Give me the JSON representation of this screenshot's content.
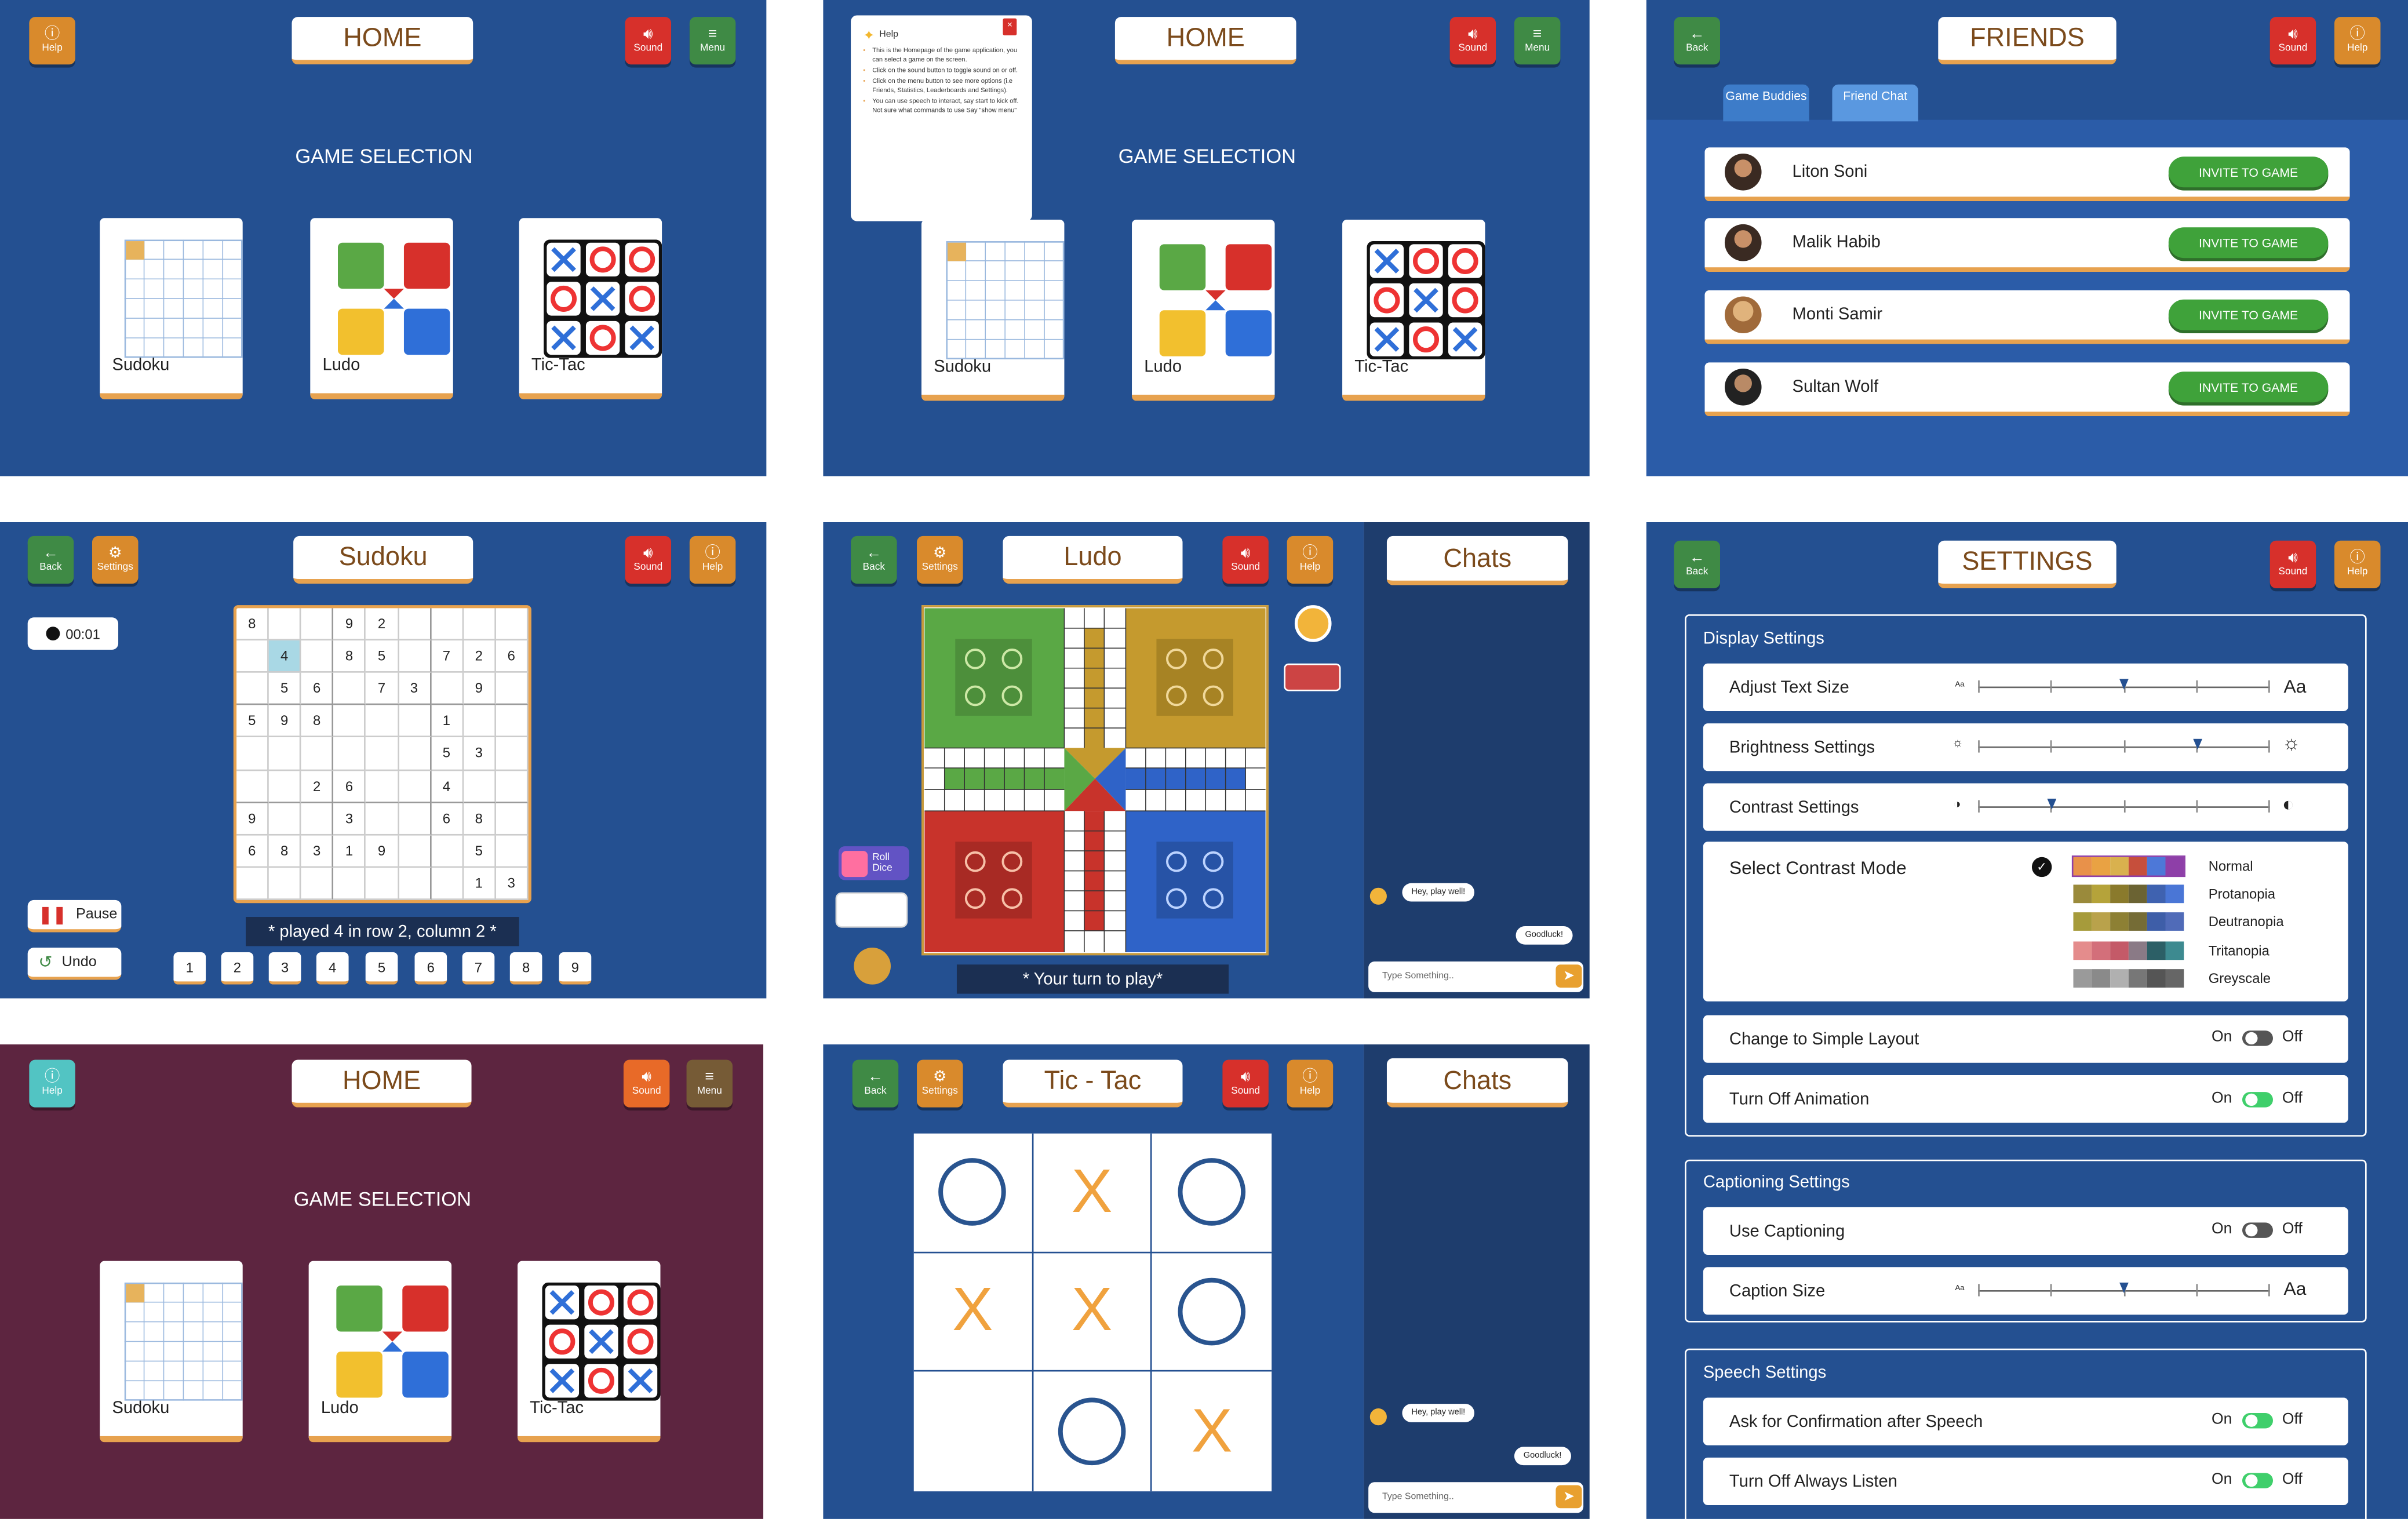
{
  "common": {
    "help": "Help",
    "sound": "Sound",
    "menu": "Menu",
    "back": "Back",
    "settings": "Settings",
    "game_selection": "GAME SELECTION",
    "home": "HOME",
    "chats": "Chats",
    "type_placeholder": "Type Something..",
    "msg_in": "Hey, play well!",
    "msg_out": "Goodluck!"
  },
  "games": [
    {
      "name": "Sudoku",
      "icon": "sudoku-icon"
    },
    {
      "name": "Ludo",
      "icon": "ludo-icon"
    },
    {
      "name": "Tic-Tac",
      "icon": "tictac-icon"
    }
  ],
  "help_popup": {
    "title": "Help",
    "items": [
      "This is the Homepage of the game application, you can select a game on the screen.",
      "Click on the sound button to toggle sound on or off.",
      "Click on the menu button to see more options (i.e Friends, Statistics, Leaderboards and Settings).",
      "You can use speech to interact, say start to kick off. Not sure what commands to use Say \"show menu\""
    ]
  },
  "friends": {
    "title": "FRIENDS",
    "tabs": [
      "Game Buddies",
      "Friend Chat"
    ],
    "invite_label": "INVITE TO GAME",
    "list": [
      "Liton Soni",
      "Malik Habib",
      "Monti Samir",
      "Sultan Wolf"
    ]
  },
  "sudoku": {
    "title": "Sudoku",
    "timer": "00:01",
    "pause": "Pause",
    "undo": "Undo",
    "status": "* played 4 in row 2, column 2 *",
    "keypad": [
      "1",
      "2",
      "3",
      "4",
      "5",
      "6",
      "7",
      "8",
      "9"
    ],
    "grid": [
      [
        "8",
        "",
        "",
        "9",
        "2",
        "",
        "",
        "",
        ""
      ],
      [
        "",
        "4",
        "",
        "8",
        "5",
        "",
        "7",
        "2",
        "6"
      ],
      [
        "",
        "5",
        "6",
        "",
        "7",
        "3",
        "",
        "9",
        ""
      ],
      [
        "5",
        "9",
        "8",
        "",
        "",
        "",
        "1",
        "",
        ""
      ],
      [
        "",
        "",
        "",
        "",
        "",
        "",
        "5",
        "3",
        ""
      ],
      [
        "",
        "",
        "2",
        "6",
        "",
        "",
        "4",
        "",
        ""
      ],
      [
        "9",
        "",
        "",
        "3",
        "",
        "",
        "6",
        "8",
        ""
      ],
      [
        "6",
        "8",
        "3",
        "1",
        "9",
        "",
        "",
        "5",
        ""
      ],
      [
        "",
        "",
        "",
        "",
        "",
        "",
        "",
        "1",
        "3"
      ]
    ]
  },
  "ludo": {
    "title": "Ludo",
    "roll": "Roll Dice",
    "status": "* Your turn to play*"
  },
  "tictac": {
    "title": "Tic - Tac",
    "board": [
      "O",
      "X",
      "O",
      "X",
      "X",
      "O",
      "",
      "O",
      "X"
    ]
  },
  "settings_page": {
    "title": "SETTINGS",
    "display": {
      "heading": "Display Settings",
      "text_size": "Adjust Text Size",
      "brightness": "Brightness Settings",
      "contrast": "Contrast Settings",
      "contrast_mode": "Select Contrast Mode",
      "modes": [
        "Normal",
        "Protanopia",
        "Deutranopia",
        "Tritanopia",
        "Greyscale"
      ],
      "simple_layout": "Change to Simple Layout",
      "animation": "Turn Off Animation"
    },
    "captioning": {
      "heading": "Captioning Settings",
      "use": "Use Captioning",
      "size": "Caption Size"
    },
    "speech": {
      "heading": "Speech Settings",
      "confirm": "Ask for Confirmation after Speech",
      "listen": "Turn Off Always Listen"
    },
    "on": "On",
    "off": "Off",
    "aa_small": "Aa",
    "aa_big": "Aa"
  },
  "colors": {
    "blue": "#245091",
    "maroon": "#5d2540",
    "accent": "#e7a24f"
  }
}
